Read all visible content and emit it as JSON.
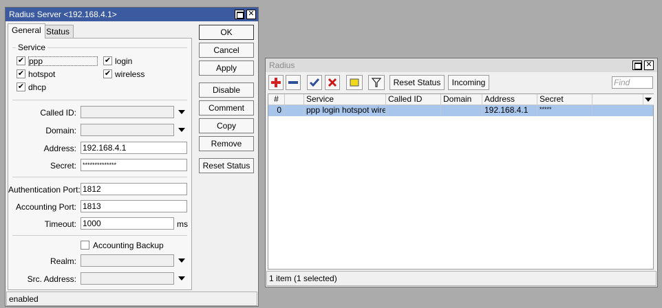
{
  "radius_server": {
    "title": "Radius Server <192.168.4.1>",
    "tabs": [
      {
        "label": "General",
        "selected": true
      },
      {
        "label": "Status",
        "selected": false
      }
    ],
    "service_label": "Service",
    "services": [
      {
        "label": "ppp",
        "checked": true
      },
      {
        "label": "login",
        "checked": true
      },
      {
        "label": "hotspot",
        "checked": true
      },
      {
        "label": "wireless",
        "checked": true
      },
      {
        "label": "dhcp",
        "checked": true
      }
    ],
    "check_glyph": "✔",
    "fields": {
      "called_id": {
        "label": "Called ID:",
        "value": ""
      },
      "domain": {
        "label": "Domain:",
        "value": ""
      },
      "address": {
        "label": "Address:",
        "value": "192.168.4.1"
      },
      "secret": {
        "label": "Secret:",
        "value": "**************"
      },
      "auth_port": {
        "label": "Authentication Port:",
        "value": "1812"
      },
      "acct_port": {
        "label": "Accounting Port:",
        "value": "1813"
      },
      "timeout": {
        "label": "Timeout:",
        "value": "1000",
        "unit": "ms"
      },
      "accounting_backup": {
        "label": "Accounting Backup",
        "checked": false
      },
      "realm": {
        "label": "Realm:",
        "value": ""
      },
      "src_address": {
        "label": "Src. Address:",
        "value": ""
      }
    },
    "buttons": {
      "ok": "OK",
      "cancel": "Cancel",
      "apply": "Apply",
      "disable": "Disable",
      "comment": "Comment",
      "copy": "Copy",
      "remove": "Remove",
      "reset_status": "Reset Status"
    },
    "status": "enabled"
  },
  "radius_list": {
    "title": "Radius",
    "toolbar": {
      "reset_status": "Reset Status",
      "incoming": "Incoming",
      "find_placeholder": "Find"
    },
    "columns": [
      "#",
      "",
      "Service",
      "Called ID",
      "Domain",
      "Address",
      "Secret"
    ],
    "rows": [
      {
        "num": "0",
        "flag": "",
        "service": "ppp login hotspot wirel...",
        "called_id": "",
        "domain": "",
        "address": "192.168.4.1",
        "secret": "*****"
      }
    ],
    "status": "1 item (1 selected)"
  },
  "colors": {
    "active_title": "#3c5a9f",
    "selected_row": "#a8c6ec",
    "add_icon": "#d42222",
    "remove_icon": "#2f4f9a",
    "enable_icon": "#2f4f9a",
    "disable_icon": "#c81818",
    "comment_icon": "#f0d81e"
  }
}
